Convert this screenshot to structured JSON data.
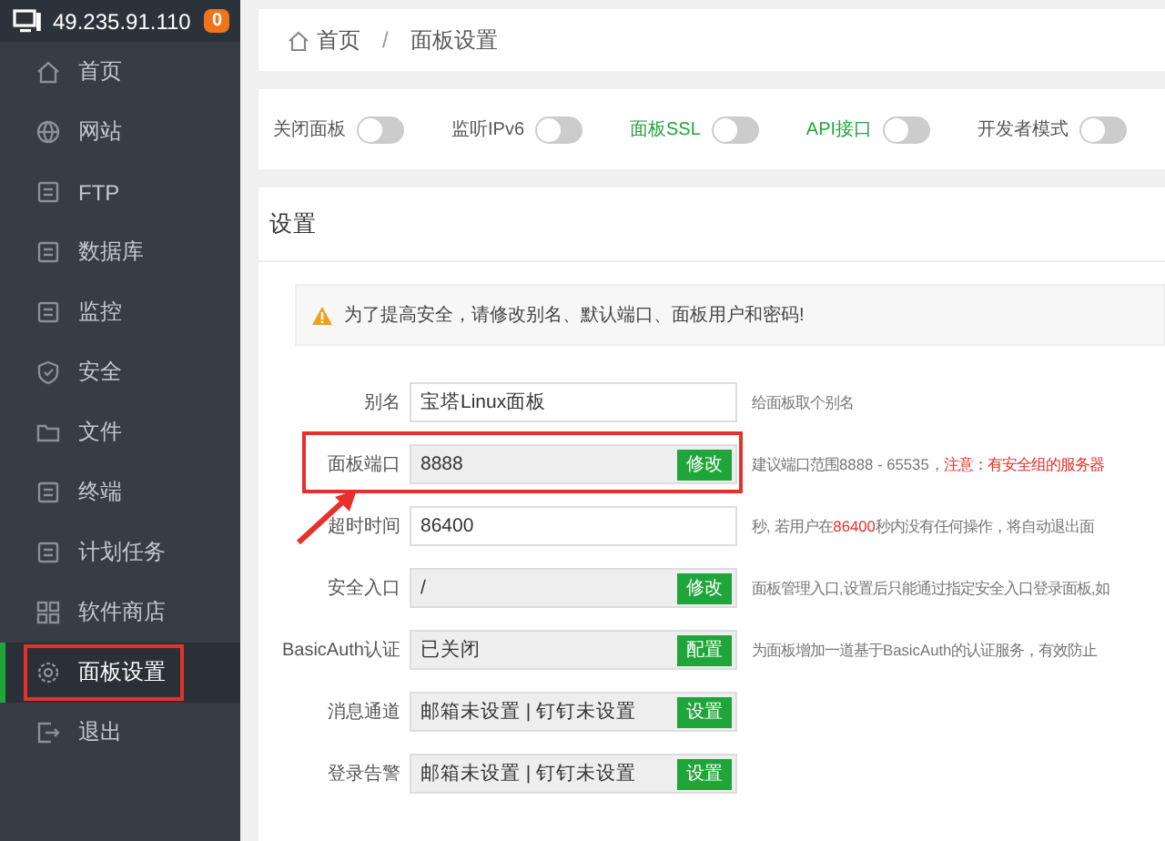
{
  "header": {
    "ip": "49.235.91.110",
    "badge": "0"
  },
  "sidebar": {
    "items": [
      {
        "label": "首页",
        "selected": false
      },
      {
        "label": "网站",
        "selected": false
      },
      {
        "label": "FTP",
        "selected": false
      },
      {
        "label": "数据库",
        "selected": false
      },
      {
        "label": "监控",
        "selected": false
      },
      {
        "label": "安全",
        "selected": false
      },
      {
        "label": "文件",
        "selected": false
      },
      {
        "label": "终端",
        "selected": false
      },
      {
        "label": "计划任务",
        "selected": false
      },
      {
        "label": "软件商店",
        "selected": false
      },
      {
        "label": "面板设置",
        "selected": true,
        "annotated": true
      },
      {
        "label": "退出",
        "selected": false
      }
    ]
  },
  "breadcrumb": [
    "首页",
    "面板设置"
  ],
  "breadcrumb_separator": "/",
  "toggles": [
    {
      "label": "关闭面板",
      "on": false,
      "color": "#555555"
    },
    {
      "label": "监听IPv6",
      "on": false,
      "color": "#555555"
    },
    {
      "label": "面板SSL",
      "on": false,
      "color": "#20a53a"
    },
    {
      "label": "API接口",
      "on": false,
      "color": "#20a53a"
    },
    {
      "label": "开发者模式",
      "on": false,
      "color": "#555555"
    }
  ],
  "settings": {
    "title": "设置",
    "alert": "为了提高安全，请修改别名、默认端口、面板用户和密码!",
    "rows": [
      {
        "label": "别名",
        "value": "宝塔Linux面板",
        "editable": true,
        "description": "给面板取个别名"
      },
      {
        "label": "面板端口",
        "value": "8888",
        "editable": false,
        "button": "修改",
        "annotated": true,
        "description": "建议端口范围8888 - 65535，",
        "warning": "注意：有安全组的服务器"
      },
      {
        "label": "超时时间",
        "value": "86400",
        "editable": true,
        "description": "秒, 若用户在**86400**秒内没有任何操作，将自动退出面"
      },
      {
        "label": "安全入口",
        "value": "/",
        "editable": false,
        "button": "修改",
        "description": "面板管理入口,设置后只能通过指定安全入口登录面板,如"
      },
      {
        "label": "BasicAuth认证",
        "value": "已关闭",
        "editable": false,
        "button": "配置",
        "description": "为面板增加一道基于BasicAuth的认证服务，有效防止"
      },
      {
        "label": "消息通道",
        "value": "邮箱未设置 | 钉钉未设置",
        "editable": false,
        "button": "设置"
      },
      {
        "label": "登录告警",
        "value": "邮箱未设置 | 钉钉未设置",
        "editable": false,
        "button": "设置"
      }
    ]
  }
}
